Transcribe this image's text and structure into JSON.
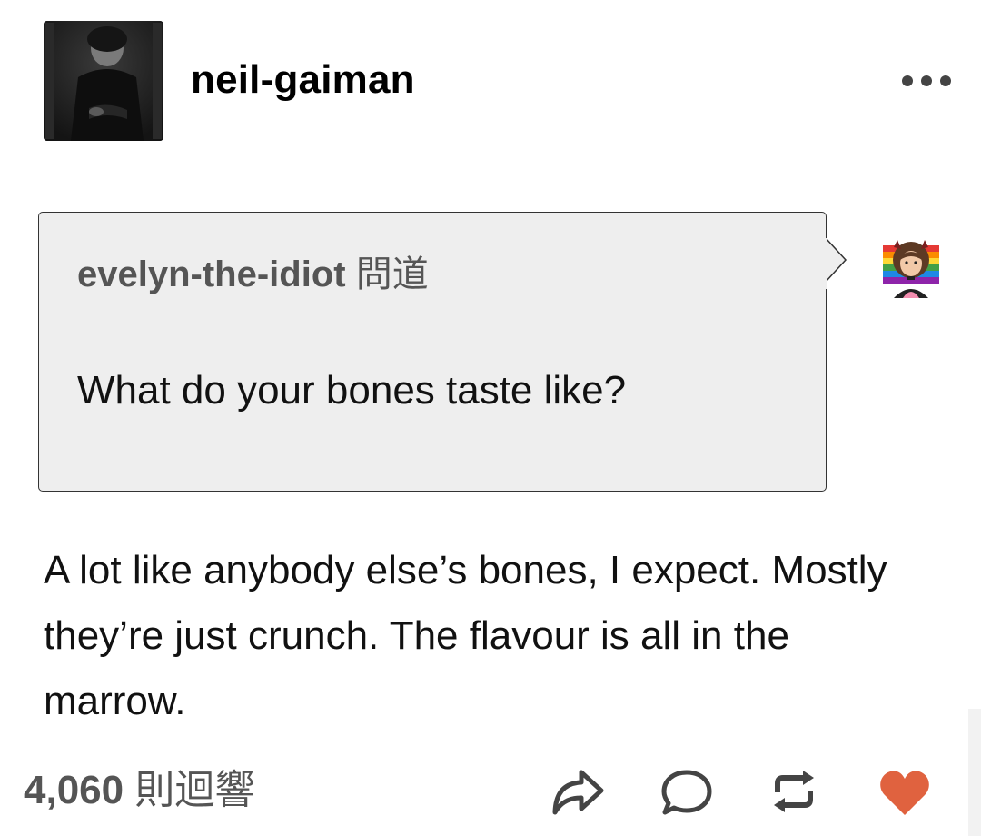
{
  "post": {
    "author": "neil-gaiman",
    "more_icon": "ellipsis-icon",
    "ask": {
      "asker": "evelyn-the-idiot",
      "asked_label": "問道",
      "question": "What do your bones taste like?"
    },
    "answer": "A lot like anybody else’s bones, I expect. Mostly they’re just crunch. The flavour is all in the marrow.",
    "footer": {
      "notes_count": "4,060",
      "notes_label": "則迴響",
      "actions": [
        "share-icon",
        "reply-icon",
        "reblog-icon",
        "like-icon"
      ]
    }
  },
  "colors": {
    "ask_background": "#eeeeee",
    "ask_border": "#333333",
    "muted_text": "#555555",
    "like_active": "#e0623f"
  }
}
